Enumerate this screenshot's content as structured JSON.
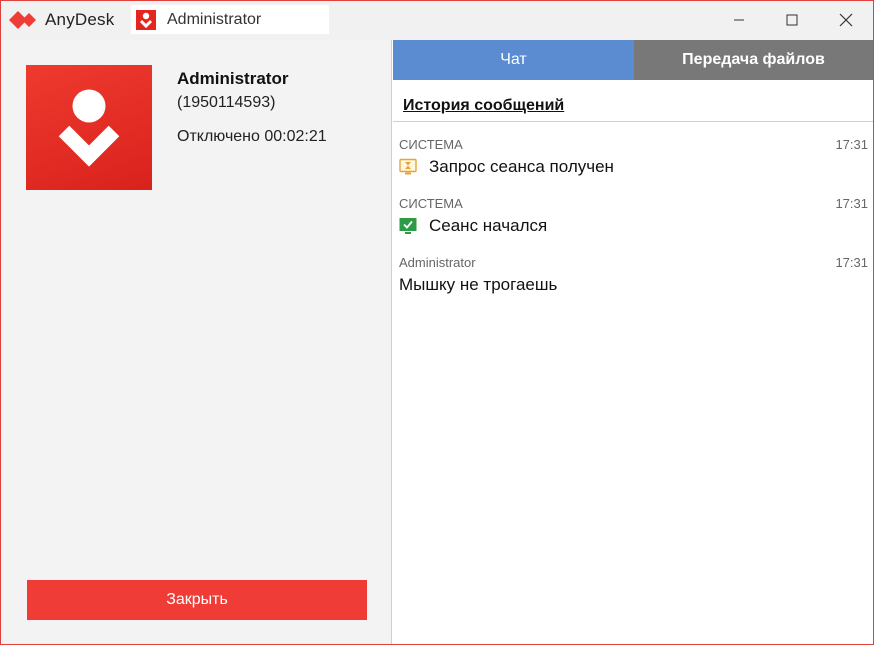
{
  "app": {
    "name": "AnyDesk",
    "tab_title": "Administrator",
    "brand_color": "#ef3c37"
  },
  "window_controls": [
    "minimize-icon",
    "maximize-icon",
    "close-icon"
  ],
  "user": {
    "name": "Administrator",
    "id": "(1950114593)",
    "status": "Отключено 00:02:21"
  },
  "actions": {
    "close_label": "Закрыть"
  },
  "tabs": [
    {
      "label": "Чат",
      "active": true,
      "color": "#5b8bd1"
    },
    {
      "label": "Передача файлов",
      "active": false,
      "color": "#787878"
    }
  ],
  "history": {
    "title": "История сообщений",
    "messages": [
      {
        "sender": "СИСТЕМА",
        "time": "17:31",
        "text": "Запрос сеанса получен",
        "icon": "hourglass-monitor-icon"
      },
      {
        "sender": "СИСТЕМА",
        "time": "17:31",
        "text": "Сеанс начался",
        "icon": "check-monitor-icon"
      },
      {
        "sender": "Administrator",
        "time": "17:31",
        "text": "Мышку не трогаешь",
        "icon": ""
      }
    ]
  }
}
